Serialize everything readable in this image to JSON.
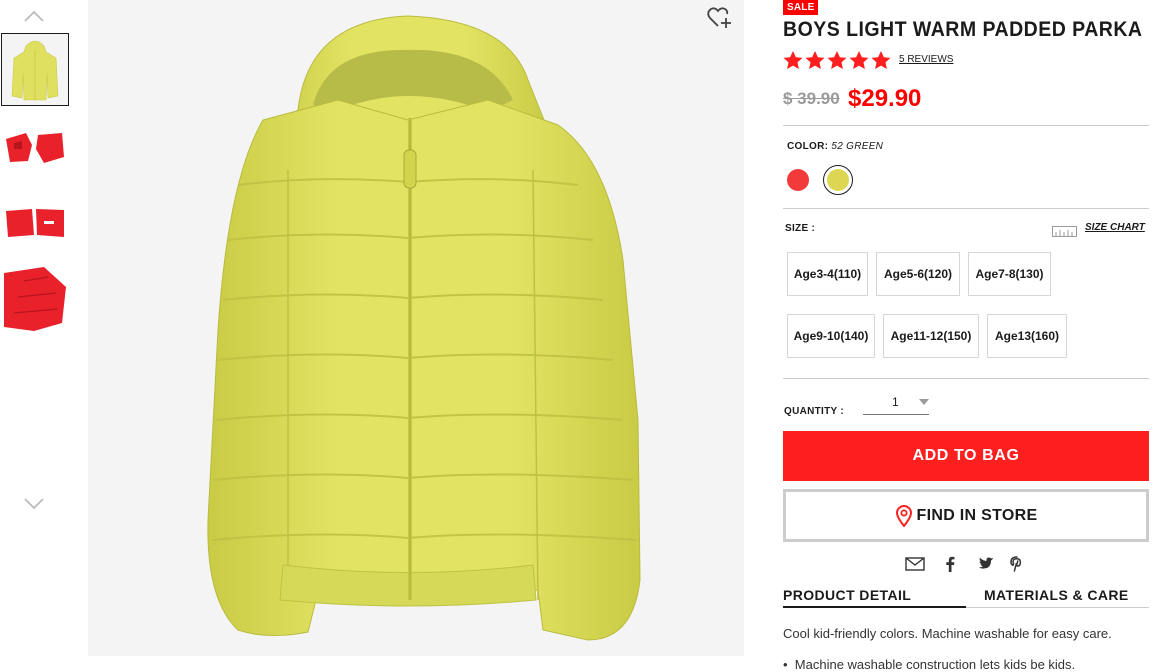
{
  "thumbnails": [
    {
      "name": "thumb-yellow-jacket-front",
      "color": "#dfe060"
    },
    {
      "name": "thumb-red-jacket-pair",
      "color": "#e8212b"
    },
    {
      "name": "thumb-red-jacket-folded",
      "color": "#e8212b"
    },
    {
      "name": "thumb-red-jacket-detail",
      "color": "#e8212b"
    }
  ],
  "product": {
    "sale_badge": "SALE",
    "title": "BOYS LIGHT WARM PADDED PARKA",
    "rating": 5,
    "reviews_label": "5 REVIEWS",
    "original_price": "$ 39.90",
    "sale_price": "$29.90"
  },
  "color": {
    "label": "COLOR:",
    "selected_name": "52 GREEN",
    "swatches": [
      {
        "name": "red",
        "hex": "#f23a3a"
      },
      {
        "name": "green",
        "hex": "#dcd653"
      }
    ]
  },
  "size": {
    "label": "SIZE :",
    "chart_link": "SIZE CHART",
    "options": [
      "Age3-4(110)",
      "Age5-6(120)",
      "Age7-8(130)",
      "Age9-10(140)",
      "Age11-12(150)",
      "Age13(160)"
    ]
  },
  "quantity": {
    "label": "QUANTITY :",
    "value": "1"
  },
  "actions": {
    "add_to_bag": "ADD TO BAG",
    "find_in_store": "FIND IN STORE"
  },
  "share_icons": [
    "email-icon",
    "facebook-icon",
    "twitter-icon",
    "pinterest-icon"
  ],
  "tabs": [
    {
      "label": "PRODUCT DETAIL",
      "active": true
    },
    {
      "label": "MATERIALS & CARE",
      "active": false
    }
  ],
  "detail": {
    "description": "Cool kid-friendly colors. Machine washable for easy care.",
    "bullets": [
      "Machine washable construction lets kids be kids."
    ]
  },
  "colors": {
    "accent_red": "#ff1f1f",
    "jacket_yellow": "#dfe060"
  }
}
